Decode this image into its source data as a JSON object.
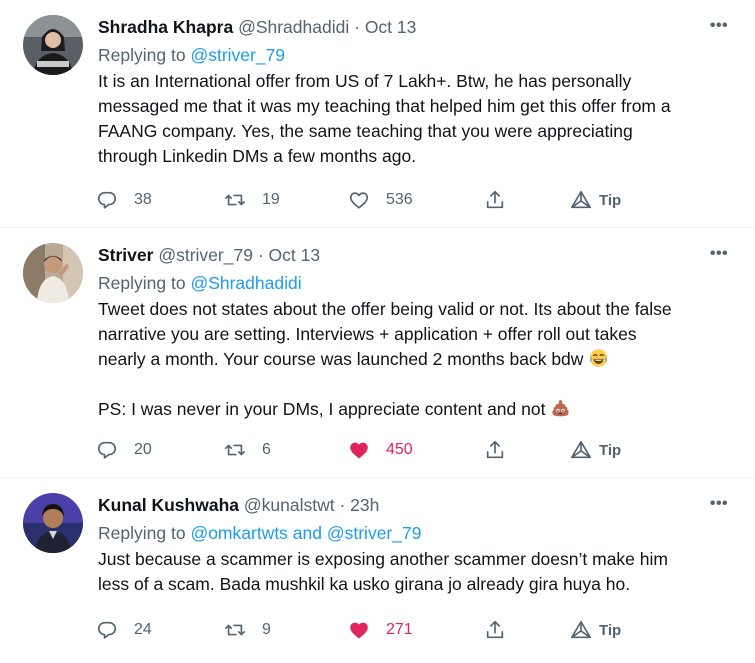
{
  "tweets": [
    {
      "name": "Shradha Khapra",
      "handle": "@Shradhadidi",
      "separator": "·",
      "date": "Oct 13",
      "replying_prefix": "Replying to",
      "replying_to": "@striver_79",
      "body": [
        "It is an International offer from US of 7 Lakh+. Btw, he has personally",
        "messaged me that it was my teaching that helped him get this offer from a",
        "FAANG company. Yes, the same teaching that you were appreciating",
        "through Linkedin DMs a few months ago."
      ],
      "replies": "38",
      "retweets": "19",
      "likes": "536",
      "liked": false,
      "tip_label": "Tip"
    },
    {
      "name": "Striver",
      "handle": "@striver_79",
      "separator": "·",
      "date": "Oct 13",
      "replying_prefix": "Replying to",
      "replying_to": "@Shradhadidi",
      "body": [
        "Tweet does not states about the offer being valid or not. Its about the false",
        "narrative you are setting. Interviews + application + offer roll out takes",
        "nearly a month. Your course was launched 2 months back bdw",
        "PS: I was never in your DMs, I appreciate content and not"
      ],
      "replies": "20",
      "retweets": "6",
      "likes": "450",
      "liked": true,
      "tip_label": "Tip"
    },
    {
      "name": "Kunal Kushwaha",
      "handle": "@kunalstwt",
      "separator": "·",
      "date": "23h",
      "replying_prefix": "Replying to",
      "replying_to": "@omkartwts and @striver_79",
      "body": [
        "Just because a scammer is exposing another scammer doesn’t make him",
        "less of a scam. Bada mushkil ka usko girana jo already gira huya ho."
      ],
      "replies": "24",
      "retweets": "9",
      "likes": "271",
      "liked": true,
      "tip_label": "Tip"
    }
  ],
  "colors": {
    "link": "#1d9bf0",
    "muted": "#536471",
    "like": "#e0245e",
    "text": "#0f1419"
  },
  "icons": [
    "more-icon",
    "reply-icon",
    "retweet-icon",
    "heart-icon",
    "share-icon",
    "tip-icon",
    "joy-emoji-icon",
    "poop-emoji-icon"
  ]
}
